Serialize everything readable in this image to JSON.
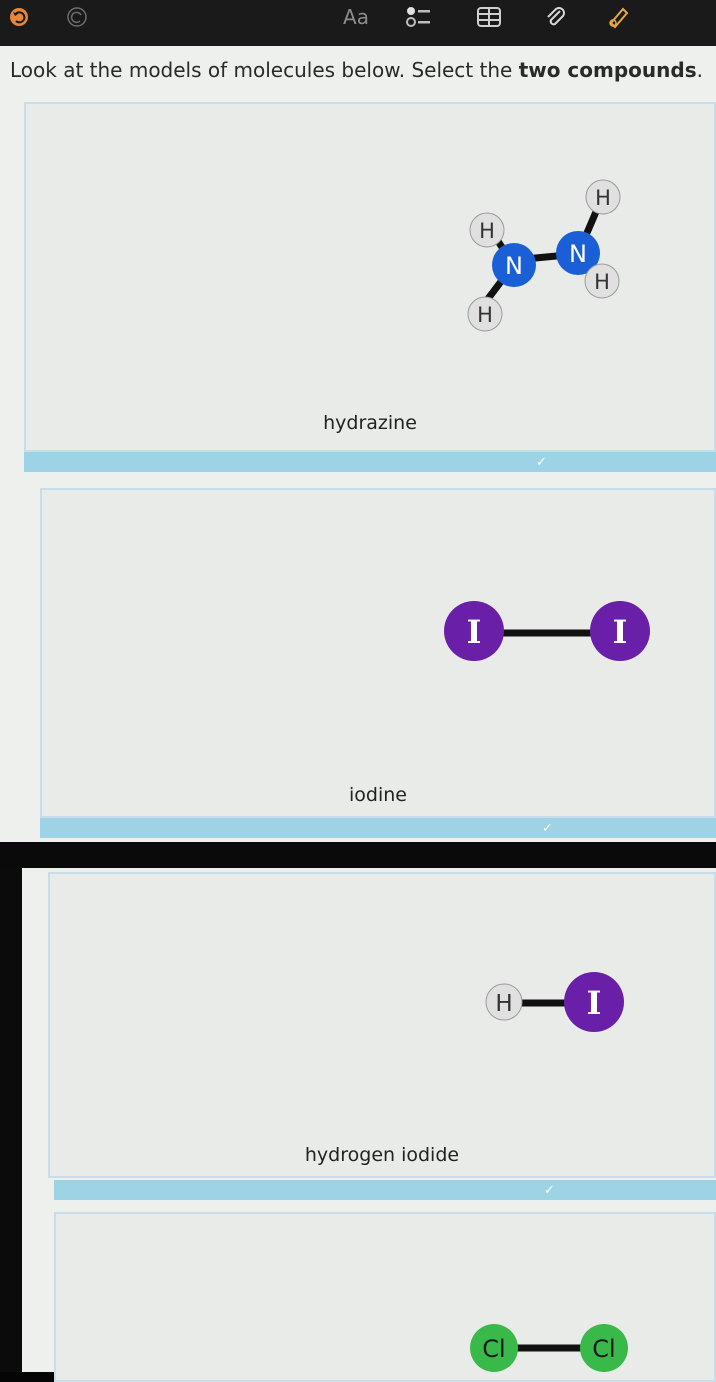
{
  "toolbar": {
    "text_tool": "Aa",
    "icons": [
      "undo-icon",
      "redo-icon",
      "text-format-icon",
      "checklist-icon",
      "table-icon",
      "paperclip-icon",
      "pen-icon"
    ]
  },
  "question": {
    "prefix": "Look at the models of molecules below. Select the ",
    "emphasis": "two compounds",
    "suffix": "."
  },
  "choices": [
    {
      "label": "hydrazine",
      "atoms": [
        {
          "symbol": "H",
          "type": "H"
        },
        {
          "symbol": "H",
          "type": "H"
        },
        {
          "symbol": "N",
          "type": "N"
        },
        {
          "symbol": "N",
          "type": "N"
        },
        {
          "symbol": "H",
          "type": "H"
        },
        {
          "symbol": "H",
          "type": "H"
        }
      ]
    },
    {
      "label": "iodine",
      "atoms": [
        {
          "symbol": "I",
          "type": "I"
        },
        {
          "symbol": "I",
          "type": "I"
        }
      ]
    },
    {
      "label": "hydrogen iodide",
      "atoms": [
        {
          "symbol": "H",
          "type": "H"
        },
        {
          "symbol": "I",
          "type": "I"
        }
      ]
    },
    {
      "label": "",
      "atoms": [
        {
          "symbol": "Cl",
          "type": "Cl"
        },
        {
          "symbol": "Cl",
          "type": "Cl"
        }
      ]
    }
  ],
  "colors": {
    "hydrogen": "#e0e0e0",
    "nitrogen": "#1b5fd6",
    "iodine": "#6a1fa8",
    "chlorine": "#39b94a",
    "bond": "#111111",
    "bar": "#9ed3e6"
  }
}
